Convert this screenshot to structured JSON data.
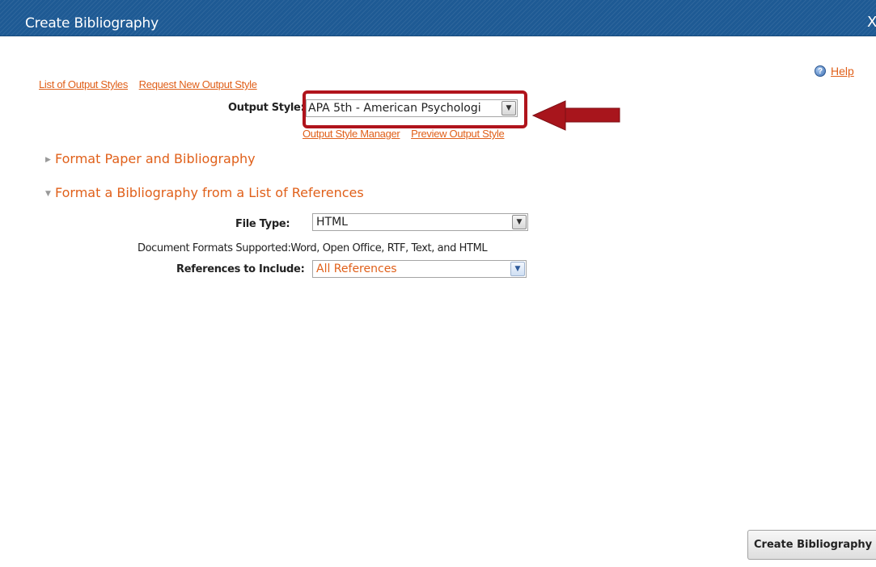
{
  "window": {
    "title": "Create Bibliography",
    "close_label": "X"
  },
  "help": {
    "icon": "help-icon",
    "label": "Help"
  },
  "top_links": [
    "List of Output Styles",
    "Request New Output Style"
  ],
  "output_style": {
    "label": "Output Style:",
    "value": "APA 5th - American Psychologi",
    "highlight_color": "#b0141c"
  },
  "output_style_links": [
    "Output Style Manager",
    "Preview Output Style"
  ],
  "sections": {
    "format_paper": {
      "label": "Format Paper and Bibliography",
      "state": "collapsed"
    },
    "format_list": {
      "label": "Format a Bibliography from a List of References",
      "state": "expanded"
    }
  },
  "file_type": {
    "label": "File Type:",
    "value": "HTML"
  },
  "document_formats": {
    "text": "Document Formats Supported:Word, Open Office, RTF, Text, and HTML"
  },
  "references": {
    "label": "References to Include:",
    "value": "All References"
  },
  "footer": {
    "create_button": "Create Bibliography"
  },
  "colors": {
    "titlebar": "#1e5a94",
    "link": "#e0601a",
    "arrow": "#a8151c"
  }
}
